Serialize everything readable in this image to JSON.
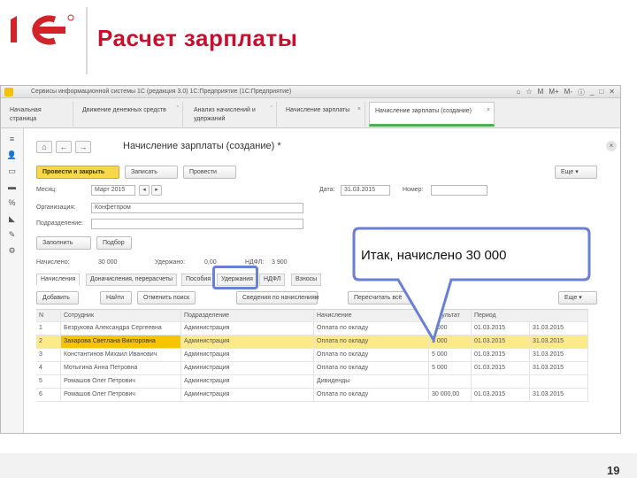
{
  "slide": {
    "title": "Расчет зарплаты",
    "page_number": "19",
    "callout_text": "Итак, начислено 30 000"
  },
  "window": {
    "title": "Сервисы информационной системы 1С (редакция 3.0) 1С:Предприятие (1С:Предприятие)",
    "controls": [
      "⌂",
      "☆",
      "M",
      "M+",
      "M-",
      "ⓘ",
      "_",
      "□",
      "✕"
    ]
  },
  "tabs": [
    {
      "label": "Начальная страница"
    },
    {
      "label": "Движение денежных средств"
    },
    {
      "label": "Анализ начислений и удержаний"
    },
    {
      "label": "Начисление зарплаты"
    },
    {
      "label": "Начисление зарплаты (создание)"
    }
  ],
  "sidebar_icons": [
    "≡",
    "👤",
    "▭",
    "▬",
    "%",
    "◣",
    "✎",
    "⚙"
  ],
  "form": {
    "title": "Начисление зарплаты (создание) *",
    "btn_post_close": "Провести и закрыть",
    "btn_save": "Записать",
    "btn_post": "Провести",
    "btn_more": "Еще ▾",
    "month_label": "Месяц:",
    "month_value": "Март 2015",
    "date_label": "Дата:",
    "date_value": "31.03.2015",
    "number_label": "Номер:",
    "org_label": "Организация:",
    "org_value": "Конфетпром",
    "dept_label": "Подразделение:",
    "btn_fill": "Заполнить",
    "btn_clear": "Подбор",
    "accrued_label": "Начислено:",
    "accrued_value": "30 000",
    "withheld_label": "Удержано:",
    "withheld_value": "0,00",
    "ndfl_label": "НДФЛ:",
    "ndfl_value": "3 900"
  },
  "subtabs": [
    {
      "label": "Начисления"
    },
    {
      "label": "Доначисления, перерасчеты"
    },
    {
      "label": "Пособия"
    },
    {
      "label": "Удержания"
    },
    {
      "label": "НДФЛ"
    },
    {
      "label": "Взносы"
    }
  ],
  "table_toolbar": {
    "add": "Добавить",
    "find": "Найти",
    "cancel_search": "Отменить поиск",
    "details": "Сведения по начислениям",
    "recalc": "Пересчитать всё",
    "more": "Еще ▾"
  },
  "table": {
    "headers": [
      "N",
      "Сотрудник",
      "Подразделение",
      "Начисление",
      "Результат",
      "Период"
    ],
    "rows": [
      [
        "1",
        "Безрукова Александра Сергеевна",
        "Администрация",
        "Оплата по окладу",
        "5 000",
        "01.03.2015",
        "31.03.2015"
      ],
      [
        "2",
        "Захарова Светлана Викторовна",
        "Администрация",
        "Оплата по окладу",
        "5 000",
        "01.03.2015",
        "31.03.2015"
      ],
      [
        "3",
        "Константинов Михаил Иванович",
        "Администрация",
        "Оплата по окладу",
        "5 000",
        "01.03.2015",
        "31.03.2015"
      ],
      [
        "4",
        "Мотыгина Анна Петровна",
        "Администрация",
        "Оплата по окладу",
        "5 000",
        "01.03.2015",
        "31.03.2015"
      ],
      [
        "5",
        "Ромашов Олег Петрович",
        "Администрация",
        "Дивиденды",
        "",
        "",
        ""
      ],
      [
        "6",
        "Ромашов Олег Петрович",
        "Администрация",
        "Оплата по окладу",
        "30 000,00",
        "01.03.2015",
        "31.03.2015"
      ]
    ]
  },
  "colors": {
    "title_red": "#c8102e",
    "logo_red": "#d2232a",
    "logo_yellow": "#f3c300",
    "selection": "#fbe98a",
    "highlight_box": "#6a7fd6"
  }
}
